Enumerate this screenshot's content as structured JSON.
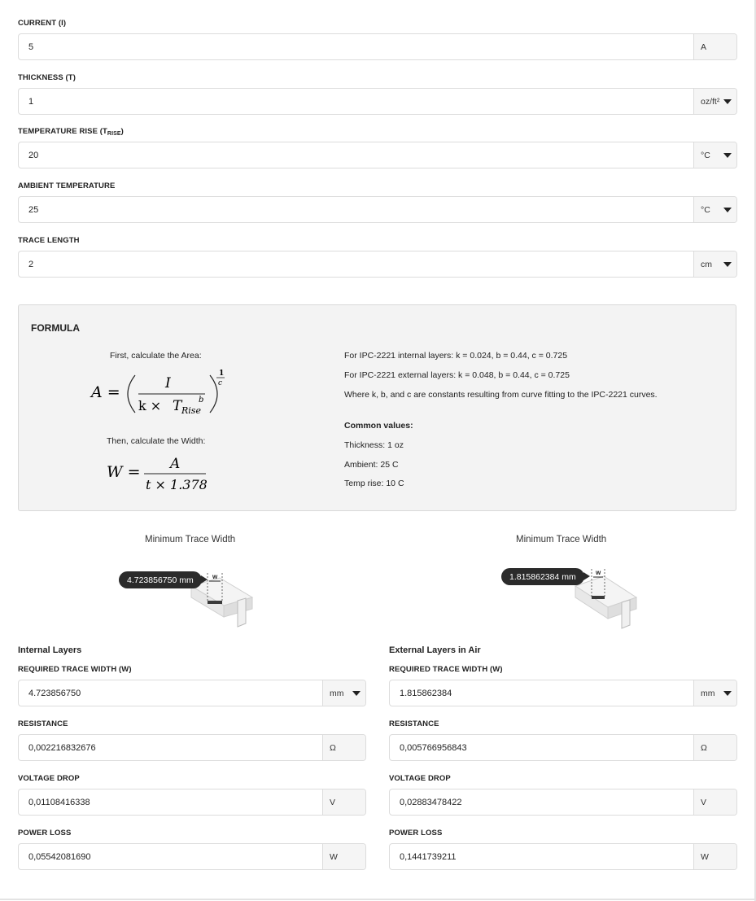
{
  "inputs": {
    "current": {
      "label": "CURRENT (I)",
      "value": "5",
      "unit": "A"
    },
    "thickness": {
      "label": "THICKNESS (T)",
      "value": "1",
      "unit": "oz/ft²"
    },
    "temperature_rise": {
      "label": "TEMPERATURE RISE (T",
      "label_sub": "RISE",
      "label_end": ")",
      "value": "20",
      "unit": "°C"
    },
    "ambient_temperature": {
      "label": "AMBIENT TEMPERATURE",
      "value": "25",
      "unit": "°C"
    },
    "trace_length": {
      "label": "TRACE LENGTH",
      "value": "2",
      "unit": "cm"
    }
  },
  "formula": {
    "title": "FORMULA",
    "step1": "First, calculate the Area:",
    "step2": "Then, calculate the Width:",
    "eq1": {
      "lhs": "A =",
      "num": "I",
      "den_k": "k × ",
      "den_T": "T",
      "den_sub": "Rise",
      "den_exp": "b",
      "exp_num": "1",
      "exp_den": "c"
    },
    "eq2": {
      "lhs": "W =",
      "num": "A",
      "den": "t × 1.378"
    },
    "notes": [
      "For IPC-2221 internal layers: k = 0.024, b = 0.44, c = 0.725",
      "For IPC-2221 external layers: k = 0.048, b = 0.44, c = 0.725",
      "Where k, b, and c are constants resulting from curve fitting to the IPC-2221 curves."
    ],
    "common_title": "Common values:",
    "common": [
      "Thickness: 1 oz",
      "Ambient: 25 C",
      "Temp rise: 10 C"
    ]
  },
  "results": {
    "internal": {
      "diagram_title": "Minimum Trace Width",
      "bubble": "4.723856750 mm",
      "w_label": "w",
      "section_title": "Internal Layers",
      "width": {
        "label": "REQUIRED TRACE WIDTH (W)",
        "value": "4.723856750",
        "unit": "mm"
      },
      "resistance": {
        "label": "RESISTANCE",
        "value": "0,002216832676",
        "unit": "Ω"
      },
      "voltage_drop": {
        "label": "VOLTAGE DROP",
        "value": "0,01108416338",
        "unit": "V"
      },
      "power_loss": {
        "label": "POWER LOSS",
        "value": "0,05542081690",
        "unit": "W"
      }
    },
    "external": {
      "diagram_title": "Minimum Trace Width",
      "bubble": "1.815862384 mm",
      "w_label": "w",
      "section_title": "External Layers in Air",
      "width": {
        "label": "REQUIRED TRACE WIDTH (W)",
        "value": "1.815862384",
        "unit": "mm"
      },
      "resistance": {
        "label": "RESISTANCE",
        "value": "0,005766956843",
        "unit": "Ω"
      },
      "voltage_drop": {
        "label": "VOLTAGE DROP",
        "value": "0,02883478422",
        "unit": "V"
      },
      "power_loss": {
        "label": "POWER LOSS",
        "value": "0,1441739211",
        "unit": "W"
      }
    }
  }
}
